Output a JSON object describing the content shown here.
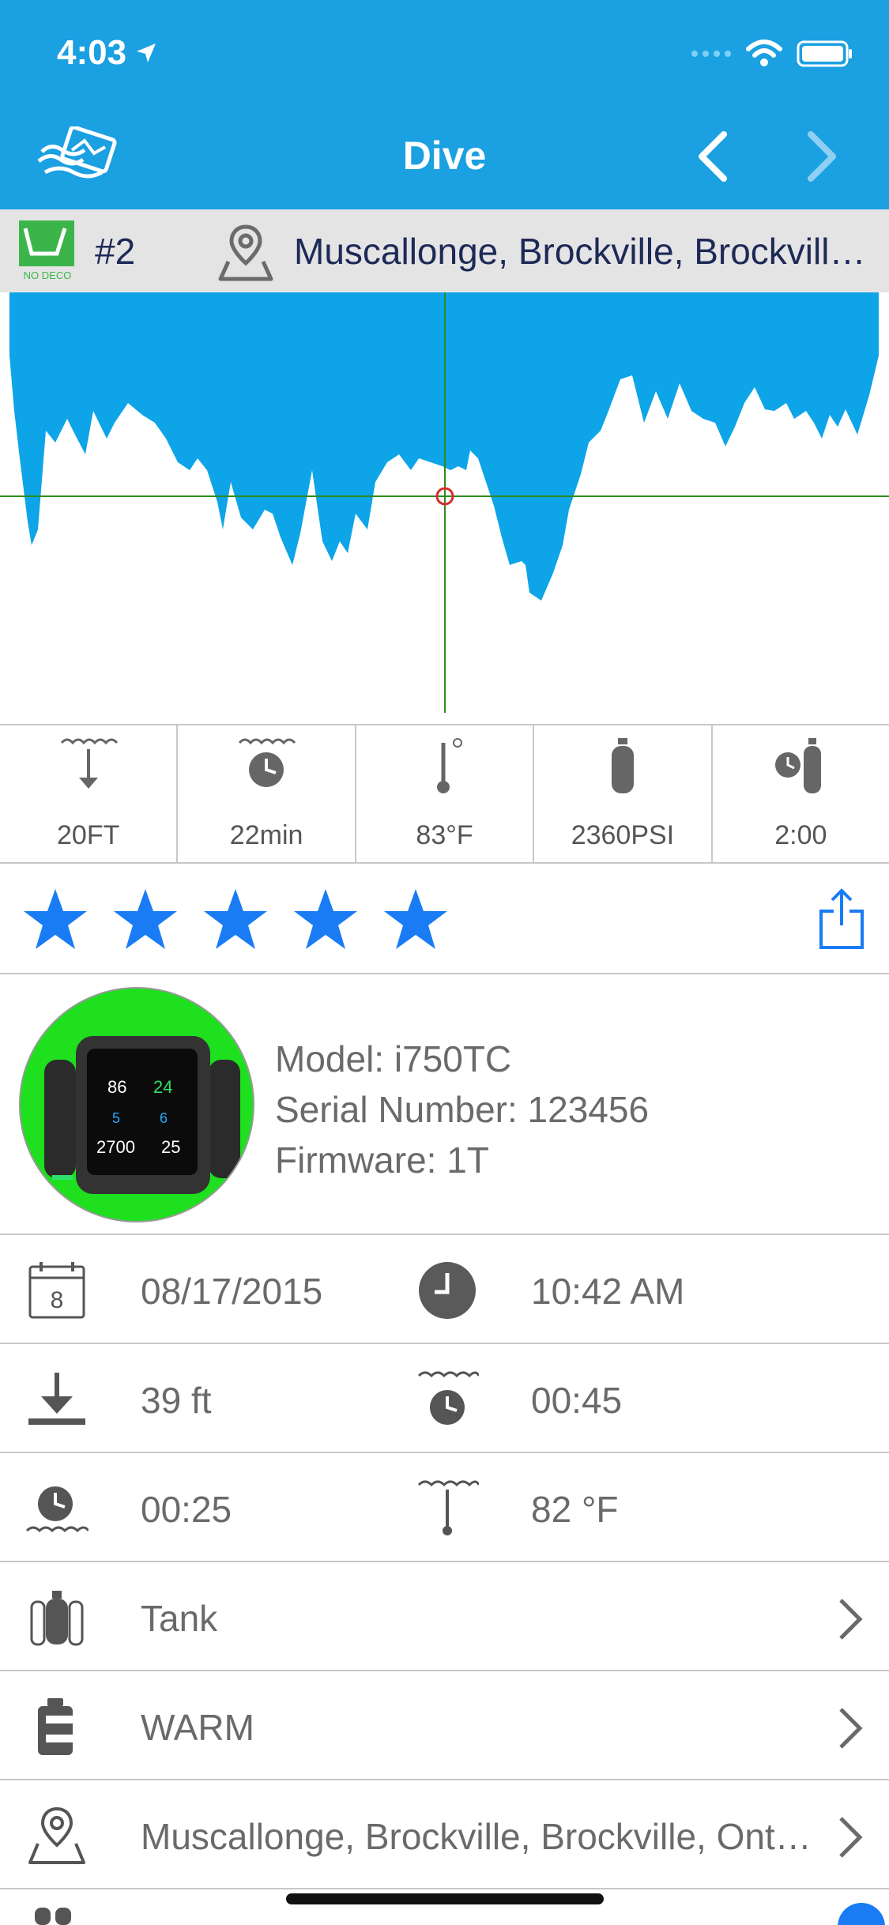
{
  "status": {
    "time": "4:03"
  },
  "nav": {
    "title": "Dive"
  },
  "infobar": {
    "dive_number": "#2",
    "nodeco_label": "NO DECO",
    "location": "Muscallonge, Brockville, Brockville, Ontario"
  },
  "colors": {
    "accent": "#1ba0e1",
    "profile_fill": "#0ea4e8",
    "crosshair": "#2e8b1e",
    "star": "#1a7cf5",
    "device_bg": "#1ee01e"
  },
  "stats": [
    {
      "icon": "max-depth-icon",
      "value": "20FT"
    },
    {
      "icon": "dive-time-icon",
      "value": "22min"
    },
    {
      "icon": "temperature-icon",
      "value": "83°F"
    },
    {
      "icon": "tank-pressure-icon",
      "value": "2360PSI"
    },
    {
      "icon": "air-time-icon",
      "value": "2:00"
    }
  ],
  "rating": {
    "stars": 5,
    "max": 5
  },
  "device": {
    "model": "Model: i750TC",
    "serial": "Serial Number: 123456",
    "firmware": "Firmware: 1T",
    "screen_values": {
      "a": "86",
      "b": "24",
      "c": "5",
      "d": "6",
      "e": "2700",
      "f": "25"
    }
  },
  "details": {
    "date": "08/17/2015",
    "date_day": "8",
    "time": "10:42 AM",
    "max_depth": "39 ft",
    "bottom_time": "00:45",
    "surface_interval": "00:25",
    "water_temp": "82 °F",
    "tank": "Tank",
    "exposure": "WARM",
    "location": "Muscallonge, Brockville, Brockville, Ontario"
  }
}
